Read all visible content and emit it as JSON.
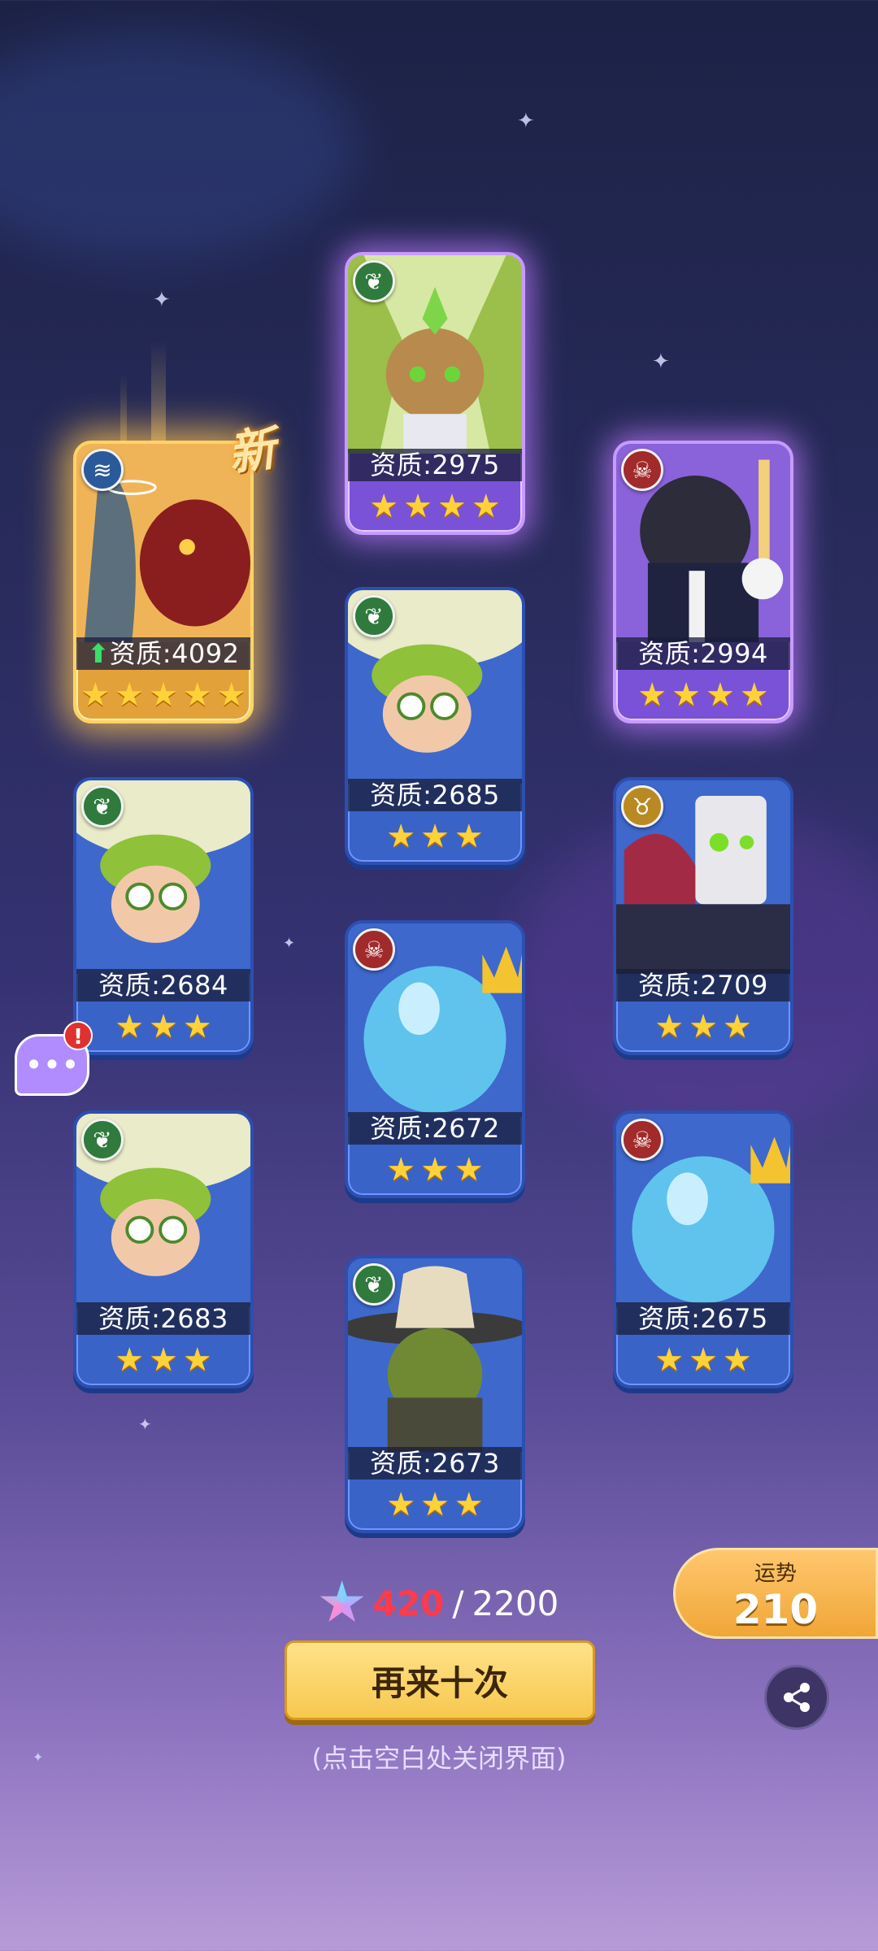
{
  "cards": [
    {
      "id": "c1",
      "element": "nature",
      "stat_label": "资质:2975",
      "stars": 4,
      "rarity": "purple"
    },
    {
      "id": "c2",
      "element": "fire",
      "stat_label": "资质:2994",
      "stars": 4,
      "rarity": "purple"
    },
    {
      "id": "c3",
      "element": "water",
      "stat_label": "资质:4092",
      "stars": 5,
      "rarity": "gold",
      "is_new": true
    },
    {
      "id": "c4",
      "element": "nature",
      "stat_label": "资质:2685",
      "stars": 3,
      "rarity": "blue"
    },
    {
      "id": "c5",
      "element": "nature",
      "stat_label": "资质:2684",
      "stars": 3,
      "rarity": "blue"
    },
    {
      "id": "c6",
      "element": "gold",
      "stat_label": "资质:2709",
      "stars": 3,
      "rarity": "blue"
    },
    {
      "id": "c7",
      "element": "fire",
      "stat_label": "资质:2672",
      "stars": 3,
      "rarity": "blue"
    },
    {
      "id": "c8",
      "element": "nature",
      "stat_label": "资质:2683",
      "stars": 3,
      "rarity": "blue"
    },
    {
      "id": "c9",
      "element": "fire",
      "stat_label": "资质:2675",
      "stars": 3,
      "rarity": "blue"
    },
    {
      "id": "c10",
      "element": "nature",
      "stat_label": "资质:2673",
      "stars": 3,
      "rarity": "blue"
    }
  ],
  "new_tag": "新",
  "counter": {
    "current": "420",
    "separator": "/",
    "max": "2200"
  },
  "again_button": "再来十次",
  "hint": "(点击空白处关闭界面)",
  "luck": {
    "label": "运势",
    "value": "210"
  },
  "colors": {
    "gold": "#f7c84e",
    "purple": "#7a52d8",
    "blue": "#3a63c8",
    "accent_red": "#ff3a4a"
  }
}
